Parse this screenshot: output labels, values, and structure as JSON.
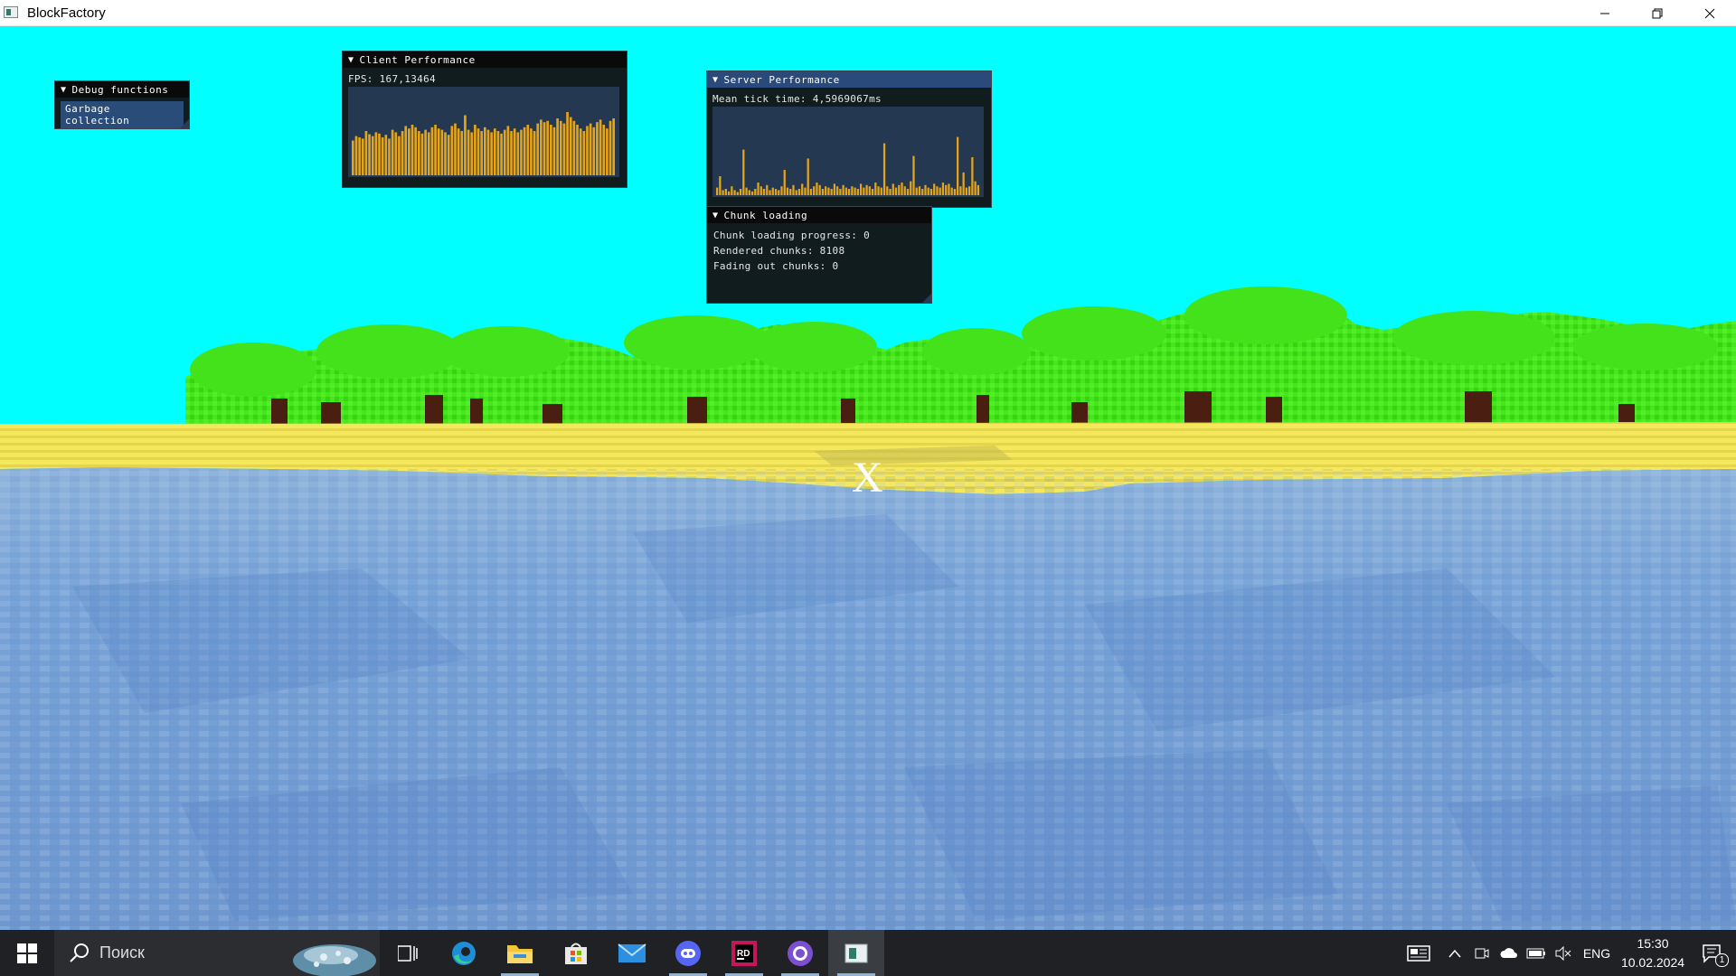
{
  "window": {
    "title": "BlockFactory"
  },
  "debug_window": {
    "title": "Debug functions",
    "button_label": "Garbage collection"
  },
  "client_window": {
    "title": "Client Performance",
    "fps_text": "FPS: 167,13464",
    "bar_levels": [
      0.55,
      0.62,
      0.6,
      0.58,
      0.7,
      0.65,
      0.62,
      0.68,
      0.66,
      0.6,
      0.64,
      0.58,
      0.72,
      0.68,
      0.62,
      0.7,
      0.78,
      0.74,
      0.8,
      0.76,
      0.7,
      0.66,
      0.72,
      0.68,
      0.76,
      0.8,
      0.74,
      0.72,
      0.68,
      0.64,
      0.78,
      0.82,
      0.74,
      0.7,
      0.95,
      0.72,
      0.68,
      0.8,
      0.74,
      0.7,
      0.76,
      0.72,
      0.68,
      0.74,
      0.7,
      0.66,
      0.72,
      0.78,
      0.7,
      0.74,
      0.68,
      0.72,
      0.76,
      0.8,
      0.74,
      0.7,
      0.82,
      0.88,
      0.84,
      0.86,
      0.8,
      0.76,
      0.9,
      0.86,
      0.82,
      1.0,
      0.92,
      0.86,
      0.8,
      0.74,
      0.7,
      0.78,
      0.82,
      0.76,
      0.84,
      0.88,
      0.8,
      0.74,
      0.86,
      0.9
    ]
  },
  "server_window": {
    "title": "Server Performance",
    "tick_text": "Mean tick time: 4,5969067ms",
    "bar_levels": [
      0.12,
      0.3,
      0.08,
      0.1,
      0.06,
      0.14,
      0.08,
      0.05,
      0.1,
      0.72,
      0.12,
      0.08,
      0.06,
      0.1,
      0.2,
      0.14,
      0.1,
      0.16,
      0.08,
      0.12,
      0.1,
      0.08,
      0.14,
      0.4,
      0.12,
      0.1,
      0.16,
      0.08,
      0.1,
      0.18,
      0.12,
      0.58,
      0.1,
      0.14,
      0.2,
      0.16,
      0.1,
      0.14,
      0.12,
      0.1,
      0.18,
      0.14,
      0.1,
      0.16,
      0.12,
      0.1,
      0.14,
      0.12,
      0.1,
      0.18,
      0.12,
      0.16,
      0.14,
      0.1,
      0.2,
      0.14,
      0.12,
      0.82,
      0.14,
      0.1,
      0.18,
      0.12,
      0.16,
      0.2,
      0.14,
      0.1,
      0.22,
      0.62,
      0.12,
      0.14,
      0.1,
      0.16,
      0.12,
      0.1,
      0.18,
      0.14,
      0.12,
      0.2,
      0.16,
      0.18,
      0.12,
      0.1,
      0.92,
      0.14,
      0.36,
      0.12,
      0.14,
      0.6,
      0.22,
      0.16
    ]
  },
  "chunk_window": {
    "title": "Chunk loading",
    "lines": [
      "Chunk loading progress: 0",
      "Rendered chunks: 8108",
      "Fading out chunks: 0"
    ]
  },
  "crosshair": "X",
  "taskbar": {
    "search_label": "Поиск",
    "lang": "ENG",
    "time": "15:30",
    "date": "10.02.2024",
    "notification_count": "1",
    "apps": [
      "task-view",
      "edge",
      "file-explorer",
      "microsoft-store",
      "mail",
      "discord",
      "rider",
      "github-desktop",
      "blockfactory"
    ]
  },
  "colors": {
    "sky": "#00ffff",
    "water": "#6c9cd6",
    "sand": "#f2e85a",
    "foliage": "#3cdc18",
    "plot_bar": "#e6a519"
  }
}
